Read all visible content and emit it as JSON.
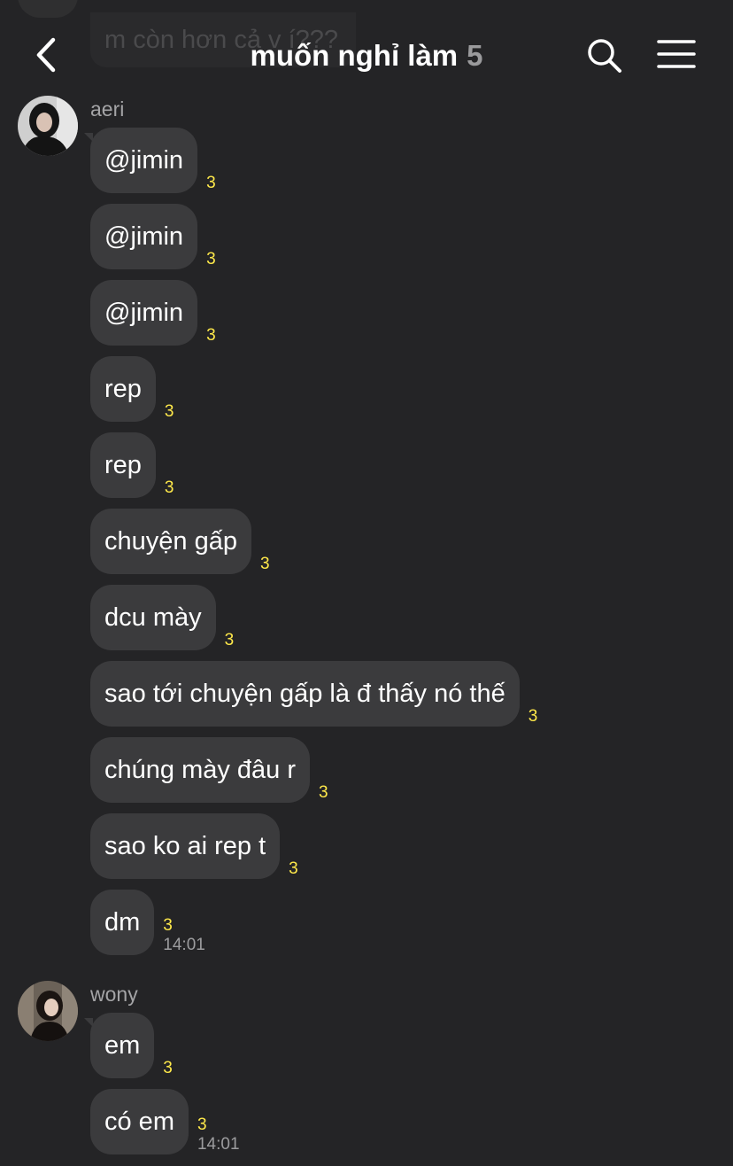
{
  "header": {
    "title": "muốn nghỉ làm",
    "member_count": "5",
    "icons": {
      "back": "chevron-left-icon",
      "search": "search-icon",
      "menu": "menu-icon"
    }
  },
  "previous_preview": "m còn hơn cả v í???",
  "groups": [
    {
      "sender": "aeri",
      "messages": [
        {
          "text": "@jimin",
          "unread": "3"
        },
        {
          "text": "@jimin",
          "unread": "3"
        },
        {
          "text": "@jimin",
          "unread": "3"
        },
        {
          "text": "rep",
          "unread": "3"
        },
        {
          "text": "rep",
          "unread": "3"
        },
        {
          "text": "chuyện gấp",
          "unread": "3"
        },
        {
          "text": "dcu mày",
          "unread": "3"
        },
        {
          "text": "sao tới chuyện gấp là đ thấy nó thế",
          "unread": "3"
        },
        {
          "text": "chúng mày đâu r",
          "unread": "3"
        },
        {
          "text": "sao ko ai rep t",
          "unread": "3"
        },
        {
          "text": "dm",
          "unread": "3",
          "time": "14:01"
        }
      ]
    },
    {
      "sender": "wony",
      "messages": [
        {
          "text": "em",
          "unread": "3"
        },
        {
          "text": "có em",
          "unread": "3",
          "time": "14:01"
        }
      ]
    }
  ],
  "colors": {
    "background": "#242426",
    "bubble": "#3b3b3d",
    "unread": "#ffe94a",
    "muted": "#9c9c9e"
  }
}
